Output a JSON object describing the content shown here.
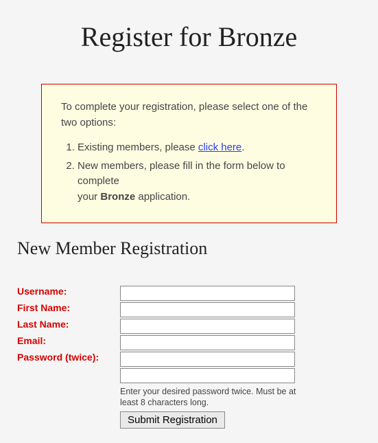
{
  "title": "Register for Bronze",
  "notice": {
    "intro": "To complete your registration, please select one of the two options:",
    "item1_prefix": "Existing members, please ",
    "item1_link": "click here",
    "item1_suffix": ".",
    "item2_line1": "New members, please fill in the form below to complete",
    "item2_line2a": "your ",
    "item2_strong": "Bronze",
    "item2_line2b": " application."
  },
  "subtitle": "New Member Registration",
  "form": {
    "username_label": "Username:",
    "firstname_label": "First Name:",
    "lastname_label": "Last Name:",
    "email_label": "Email:",
    "password_label": "Password (twice):",
    "password_hint": "Enter your desired password twice. Must be at least 8 characters long.",
    "submit_label": "Submit Registration"
  }
}
